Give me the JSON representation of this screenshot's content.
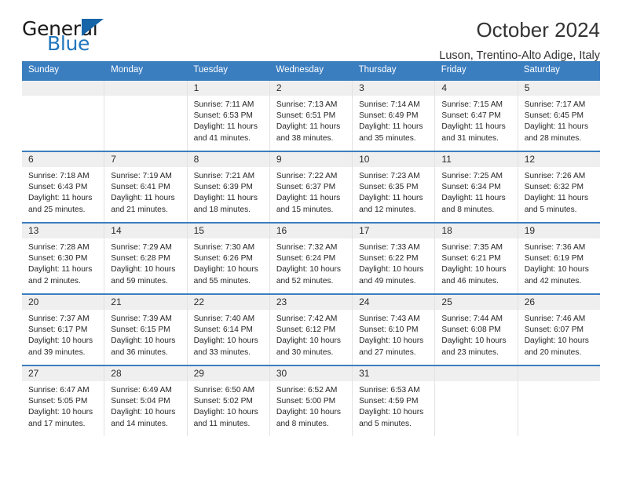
{
  "brand": {
    "name_part1": "General",
    "name_part2": "Blue",
    "accent_color": "#2176bd",
    "triangle_color": "#1565a8"
  },
  "header": {
    "title": "October 2024",
    "subtitle": "Luson, Trentino-Alto Adige, Italy"
  },
  "calendar": {
    "header_bg": "#3b7ec0",
    "weekdays": [
      "Sunday",
      "Monday",
      "Tuesday",
      "Wednesday",
      "Thursday",
      "Friday",
      "Saturday"
    ],
    "weeks": [
      [
        {
          "empty": true
        },
        {
          "empty": true
        },
        {
          "day": "1",
          "sunrise": "Sunrise: 7:11 AM",
          "sunset": "Sunset: 6:53 PM",
          "daylight_line1": "Daylight: 11 hours",
          "daylight_line2": "and 41 minutes."
        },
        {
          "day": "2",
          "sunrise": "Sunrise: 7:13 AM",
          "sunset": "Sunset: 6:51 PM",
          "daylight_line1": "Daylight: 11 hours",
          "daylight_line2": "and 38 minutes."
        },
        {
          "day": "3",
          "sunrise": "Sunrise: 7:14 AM",
          "sunset": "Sunset: 6:49 PM",
          "daylight_line1": "Daylight: 11 hours",
          "daylight_line2": "and 35 minutes."
        },
        {
          "day": "4",
          "sunrise": "Sunrise: 7:15 AM",
          "sunset": "Sunset: 6:47 PM",
          "daylight_line1": "Daylight: 11 hours",
          "daylight_line2": "and 31 minutes."
        },
        {
          "day": "5",
          "sunrise": "Sunrise: 7:17 AM",
          "sunset": "Sunset: 6:45 PM",
          "daylight_line1": "Daylight: 11 hours",
          "daylight_line2": "and 28 minutes."
        }
      ],
      [
        {
          "day": "6",
          "sunrise": "Sunrise: 7:18 AM",
          "sunset": "Sunset: 6:43 PM",
          "daylight_line1": "Daylight: 11 hours",
          "daylight_line2": "and 25 minutes."
        },
        {
          "day": "7",
          "sunrise": "Sunrise: 7:19 AM",
          "sunset": "Sunset: 6:41 PM",
          "daylight_line1": "Daylight: 11 hours",
          "daylight_line2": "and 21 minutes."
        },
        {
          "day": "8",
          "sunrise": "Sunrise: 7:21 AM",
          "sunset": "Sunset: 6:39 PM",
          "daylight_line1": "Daylight: 11 hours",
          "daylight_line2": "and 18 minutes."
        },
        {
          "day": "9",
          "sunrise": "Sunrise: 7:22 AM",
          "sunset": "Sunset: 6:37 PM",
          "daylight_line1": "Daylight: 11 hours",
          "daylight_line2": "and 15 minutes."
        },
        {
          "day": "10",
          "sunrise": "Sunrise: 7:23 AM",
          "sunset": "Sunset: 6:35 PM",
          "daylight_line1": "Daylight: 11 hours",
          "daylight_line2": "and 12 minutes."
        },
        {
          "day": "11",
          "sunrise": "Sunrise: 7:25 AM",
          "sunset": "Sunset: 6:34 PM",
          "daylight_line1": "Daylight: 11 hours",
          "daylight_line2": "and 8 minutes."
        },
        {
          "day": "12",
          "sunrise": "Sunrise: 7:26 AM",
          "sunset": "Sunset: 6:32 PM",
          "daylight_line1": "Daylight: 11 hours",
          "daylight_line2": "and 5 minutes."
        }
      ],
      [
        {
          "day": "13",
          "sunrise": "Sunrise: 7:28 AM",
          "sunset": "Sunset: 6:30 PM",
          "daylight_line1": "Daylight: 11 hours",
          "daylight_line2": "and 2 minutes."
        },
        {
          "day": "14",
          "sunrise": "Sunrise: 7:29 AM",
          "sunset": "Sunset: 6:28 PM",
          "daylight_line1": "Daylight: 10 hours",
          "daylight_line2": "and 59 minutes."
        },
        {
          "day": "15",
          "sunrise": "Sunrise: 7:30 AM",
          "sunset": "Sunset: 6:26 PM",
          "daylight_line1": "Daylight: 10 hours",
          "daylight_line2": "and 55 minutes."
        },
        {
          "day": "16",
          "sunrise": "Sunrise: 7:32 AM",
          "sunset": "Sunset: 6:24 PM",
          "daylight_line1": "Daylight: 10 hours",
          "daylight_line2": "and 52 minutes."
        },
        {
          "day": "17",
          "sunrise": "Sunrise: 7:33 AM",
          "sunset": "Sunset: 6:22 PM",
          "daylight_line1": "Daylight: 10 hours",
          "daylight_line2": "and 49 minutes."
        },
        {
          "day": "18",
          "sunrise": "Sunrise: 7:35 AM",
          "sunset": "Sunset: 6:21 PM",
          "daylight_line1": "Daylight: 10 hours",
          "daylight_line2": "and 46 minutes."
        },
        {
          "day": "19",
          "sunrise": "Sunrise: 7:36 AM",
          "sunset": "Sunset: 6:19 PM",
          "daylight_line1": "Daylight: 10 hours",
          "daylight_line2": "and 42 minutes."
        }
      ],
      [
        {
          "day": "20",
          "sunrise": "Sunrise: 7:37 AM",
          "sunset": "Sunset: 6:17 PM",
          "daylight_line1": "Daylight: 10 hours",
          "daylight_line2": "and 39 minutes."
        },
        {
          "day": "21",
          "sunrise": "Sunrise: 7:39 AM",
          "sunset": "Sunset: 6:15 PM",
          "daylight_line1": "Daylight: 10 hours",
          "daylight_line2": "and 36 minutes."
        },
        {
          "day": "22",
          "sunrise": "Sunrise: 7:40 AM",
          "sunset": "Sunset: 6:14 PM",
          "daylight_line1": "Daylight: 10 hours",
          "daylight_line2": "and 33 minutes."
        },
        {
          "day": "23",
          "sunrise": "Sunrise: 7:42 AM",
          "sunset": "Sunset: 6:12 PM",
          "daylight_line1": "Daylight: 10 hours",
          "daylight_line2": "and 30 minutes."
        },
        {
          "day": "24",
          "sunrise": "Sunrise: 7:43 AM",
          "sunset": "Sunset: 6:10 PM",
          "daylight_line1": "Daylight: 10 hours",
          "daylight_line2": "and 27 minutes."
        },
        {
          "day": "25",
          "sunrise": "Sunrise: 7:44 AM",
          "sunset": "Sunset: 6:08 PM",
          "daylight_line1": "Daylight: 10 hours",
          "daylight_line2": "and 23 minutes."
        },
        {
          "day": "26",
          "sunrise": "Sunrise: 7:46 AM",
          "sunset": "Sunset: 6:07 PM",
          "daylight_line1": "Daylight: 10 hours",
          "daylight_line2": "and 20 minutes."
        }
      ],
      [
        {
          "day": "27",
          "sunrise": "Sunrise: 6:47 AM",
          "sunset": "Sunset: 5:05 PM",
          "daylight_line1": "Daylight: 10 hours",
          "daylight_line2": "and 17 minutes."
        },
        {
          "day": "28",
          "sunrise": "Sunrise: 6:49 AM",
          "sunset": "Sunset: 5:04 PM",
          "daylight_line1": "Daylight: 10 hours",
          "daylight_line2": "and 14 minutes."
        },
        {
          "day": "29",
          "sunrise": "Sunrise: 6:50 AM",
          "sunset": "Sunset: 5:02 PM",
          "daylight_line1": "Daylight: 10 hours",
          "daylight_line2": "and 11 minutes."
        },
        {
          "day": "30",
          "sunrise": "Sunrise: 6:52 AM",
          "sunset": "Sunset: 5:00 PM",
          "daylight_line1": "Daylight: 10 hours",
          "daylight_line2": "and 8 minutes."
        },
        {
          "day": "31",
          "sunrise": "Sunrise: 6:53 AM",
          "sunset": "Sunset: 4:59 PM",
          "daylight_line1": "Daylight: 10 hours",
          "daylight_line2": "and 5 minutes."
        },
        {
          "empty": true
        },
        {
          "empty": true
        }
      ]
    ]
  }
}
